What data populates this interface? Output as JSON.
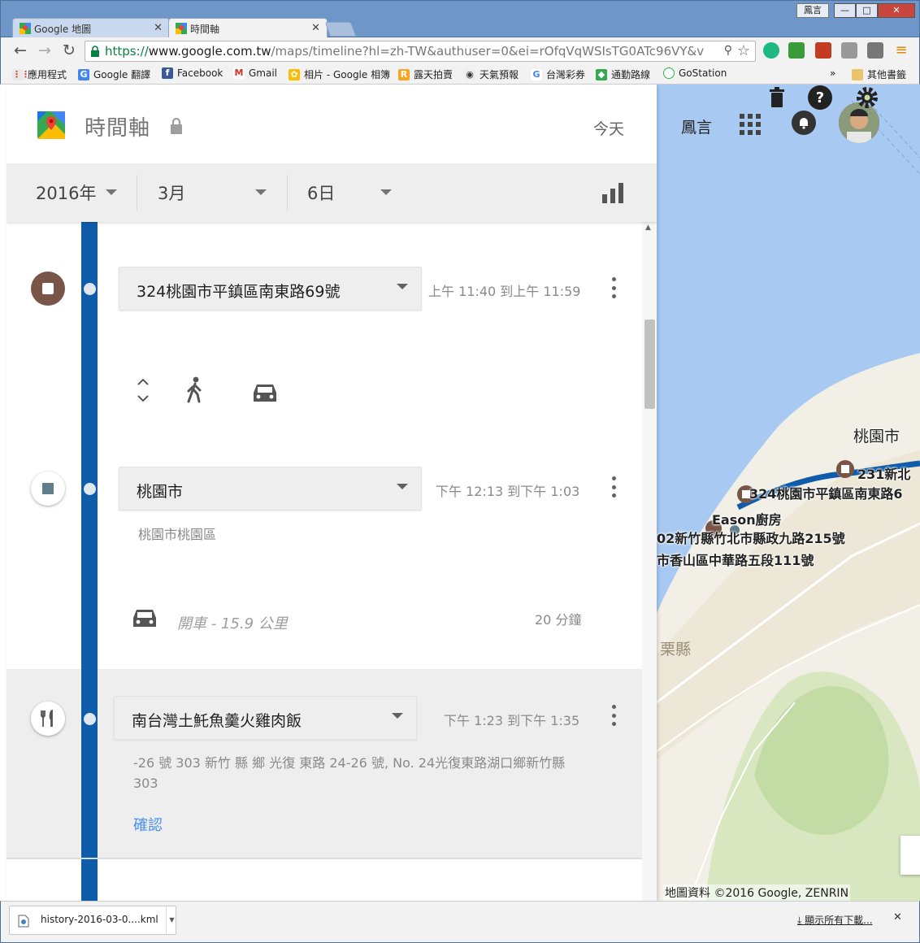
{
  "browser": {
    "tabs": [
      {
        "title": "Google 地圖",
        "active": false
      },
      {
        "title": "時間軸",
        "active": true
      }
    ],
    "user_button": "鳳言",
    "window_buttons": {
      "minimize": "—",
      "maximize": "□",
      "close": "✕"
    },
    "url": {
      "scheme": "https://",
      "host": "www.google.com.tw",
      "rest": "/maps/timeline?hl=zh-TW&authuser=0&ei=rOfqVqWSIsTG0ATc96VY&v"
    },
    "bookmarks": [
      {
        "label": "應用程式",
        "icon": "apps-icon"
      },
      {
        "label": "Google 翻譯",
        "icon": "translate-icon"
      },
      {
        "label": "Facebook",
        "icon": "facebook-icon"
      },
      {
        "label": "Gmail",
        "icon": "gmail-icon"
      },
      {
        "label": "相片 - Google 相簿",
        "icon": "photos-icon"
      },
      {
        "label": "露天拍賣",
        "icon": "ruten-icon"
      },
      {
        "label": "天氣預報",
        "icon": "weather-icon"
      },
      {
        "label": "台灣彩券",
        "icon": "google-icon"
      },
      {
        "label": "通勤路線",
        "icon": "maps-icon"
      },
      {
        "label": "GoStation",
        "icon": "gostation-icon"
      }
    ],
    "bookmarks_overflow": "»",
    "other_bookmarks": "其他書籤"
  },
  "panel": {
    "title": "時間軸",
    "today": "今天",
    "date": {
      "year": "2016年",
      "month": "3月",
      "day": "6日"
    }
  },
  "timeline": {
    "place1": {
      "name": "324桃園市平鎮區南東路69號",
      "time": "上午 11:40 到上午 11:59",
      "icon": "stop-icon"
    },
    "place2": {
      "name": "桃園市",
      "time": "下午 12:13 到下午 1:03",
      "address": "桃園市桃園區",
      "icon": "stop-icon"
    },
    "travel": {
      "mode": "開車",
      "distance": "- 15.9 公里",
      "duration": "20 分鐘"
    },
    "place3": {
      "name": "南台灣土魠魚羹火雞肉飯",
      "time": "下午 1:23 到下午 1:35",
      "address_line1": "-26 號 303 新竹 縣 鄉 光復 東路 24-26 號, No. 24光復東路湖口鄉新竹縣",
      "address_line2": "303",
      "confirm": "確認",
      "icon": "restaurant-icon"
    }
  },
  "map": {
    "language": "鳳言",
    "labels": {
      "city": "桃園市",
      "p1": "231新北",
      "p2": "324桃園市平鎮區南東路6",
      "p3": "Eason廚房",
      "p4": "02新竹縣竹北市縣政九路215號",
      "p5": "市香山區中華路五段111號",
      "county": "栗縣"
    },
    "credit": "地圖資料 ©2016 Google, ZENRIN",
    "colors": {
      "water": "#a8caf2",
      "land": "#f2efe6",
      "forest": "#c8dfab",
      "route": "#0e5caa",
      "poi": "#795548"
    }
  },
  "downloads": {
    "file": "history-2016-03-0....kml",
    "show_all": "顯示所有下載..."
  }
}
